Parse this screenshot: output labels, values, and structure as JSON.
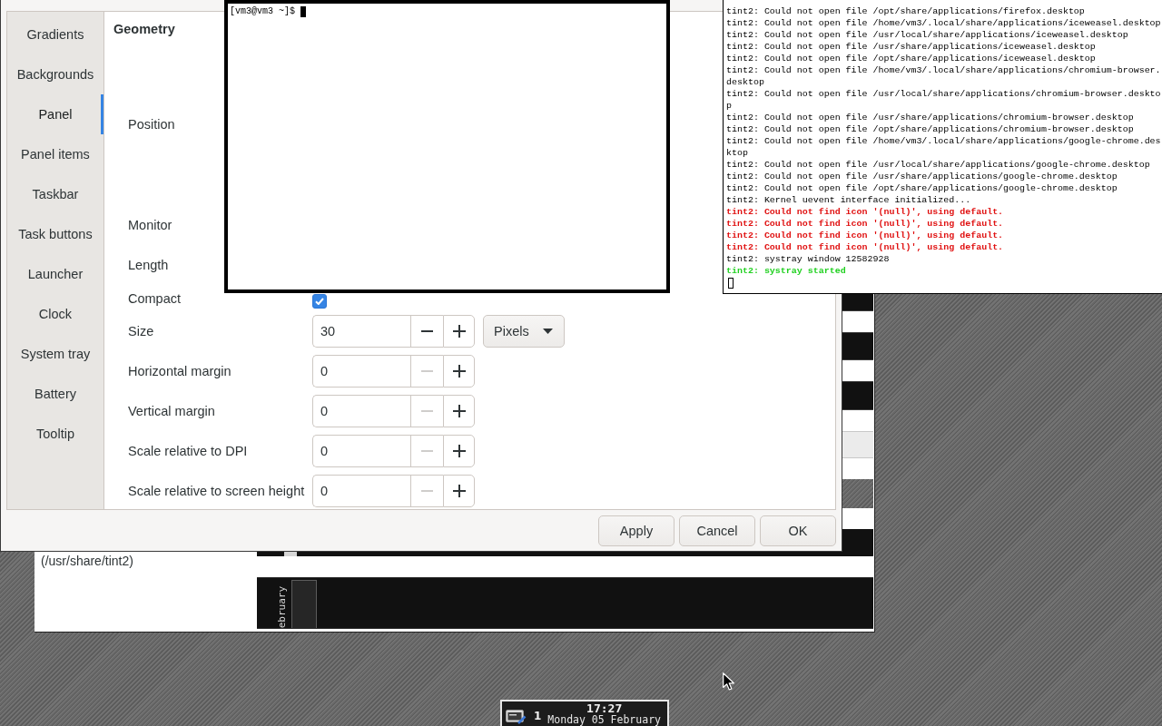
{
  "theme_window": {
    "path_label": "(/usr/share/tint2)",
    "preview_text": "ebruary"
  },
  "settings_dialog": {
    "sidebar": [
      {
        "label": "Gradients",
        "selected": false
      },
      {
        "label": "Backgrounds",
        "selected": false
      },
      {
        "label": "Panel",
        "selected": true
      },
      {
        "label": "Panel items",
        "selected": false
      },
      {
        "label": "Taskbar",
        "selected": false
      },
      {
        "label": "Task buttons",
        "selected": false
      },
      {
        "label": "Launcher",
        "selected": false
      },
      {
        "label": "Clock",
        "selected": false
      },
      {
        "label": "System tray",
        "selected": false
      },
      {
        "label": "Battery",
        "selected": false
      },
      {
        "label": "Tooltip",
        "selected": false
      }
    ],
    "section_title": "Geometry",
    "rows": [
      {
        "kind": "label",
        "label": "Position"
      },
      {
        "kind": "label",
        "label": "Monitor"
      },
      {
        "kind": "label",
        "label": "Length"
      },
      {
        "kind": "checkbox",
        "label": "Compact",
        "checked": true
      },
      {
        "kind": "spin",
        "label": "Size",
        "value": "30",
        "decrement_disabled": false,
        "unit": "Pixels"
      },
      {
        "kind": "spin",
        "label": "Horizontal margin",
        "value": "0",
        "decrement_disabled": true
      },
      {
        "kind": "spin",
        "label": "Vertical margin",
        "value": "0",
        "decrement_disabled": true
      },
      {
        "kind": "spin",
        "label": "Scale relative to DPI",
        "value": "0",
        "decrement_disabled": true
      },
      {
        "kind": "spin",
        "label": "Scale relative to screen height",
        "value": "0",
        "decrement_disabled": true
      }
    ],
    "buttons": [
      "Apply",
      "Cancel",
      "OK"
    ]
  },
  "terminal": {
    "prompt": "[vm3@vm3 ~]$"
  },
  "log_window": {
    "lines": [
      {
        "kind": "info",
        "text": "tint2: Could not open file /opt/share/applications/firefox.desktop"
      },
      {
        "kind": "info",
        "text": "tint2: Could not open file /home/vm3/.local/share/applications/iceweasel.desktop"
      },
      {
        "kind": "info",
        "text": "tint2: Could not open file /usr/local/share/applications/iceweasel.desktop"
      },
      {
        "kind": "info",
        "text": "tint2: Could not open file /usr/share/applications/iceweasel.desktop"
      },
      {
        "kind": "info",
        "text": "tint2: Could not open file /opt/share/applications/iceweasel.desktop"
      },
      {
        "kind": "info",
        "text": "tint2: Could not open file /home/vm3/.local/share/applications/chromium-browser."
      },
      {
        "kind": "info",
        "text": "desktop"
      },
      {
        "kind": "info",
        "text": "tint2: Could not open file /usr/local/share/applications/chromium-browser.deskto"
      },
      {
        "kind": "info",
        "text": "p"
      },
      {
        "kind": "info",
        "text": "tint2: Could not open file /usr/share/applications/chromium-browser.desktop"
      },
      {
        "kind": "info",
        "text": "tint2: Could not open file /opt/share/applications/chromium-browser.desktop"
      },
      {
        "kind": "info",
        "text": "tint2: Could not open file /home/vm3/.local/share/applications/google-chrome.des"
      },
      {
        "kind": "info",
        "text": "ktop"
      },
      {
        "kind": "info",
        "text": "tint2: Could not open file /usr/local/share/applications/google-chrome.desktop"
      },
      {
        "kind": "info",
        "text": "tint2: Could not open file /usr/share/applications/google-chrome.desktop"
      },
      {
        "kind": "info",
        "text": "tint2: Could not open file /opt/share/applications/google-chrome.desktop"
      },
      {
        "kind": "info",
        "text": "tint2: Kernel uevent interface initialized..."
      },
      {
        "kind": "error",
        "text": "tint2: Could not find icon '(null)', using default."
      },
      {
        "kind": "error",
        "text": "tint2: Could not find icon '(null)', using default."
      },
      {
        "kind": "error",
        "text": "tint2: Could not find icon '(null)', using default."
      },
      {
        "kind": "error",
        "text": "tint2: Could not find icon '(null)', using default."
      },
      {
        "kind": "info",
        "text": "tint2: systray window 12582928"
      },
      {
        "kind": "success",
        "text": "tint2: systray started"
      }
    ]
  },
  "taskbar": {
    "desktop": "1",
    "time": "17:27",
    "date": "Monday 05 February"
  }
}
